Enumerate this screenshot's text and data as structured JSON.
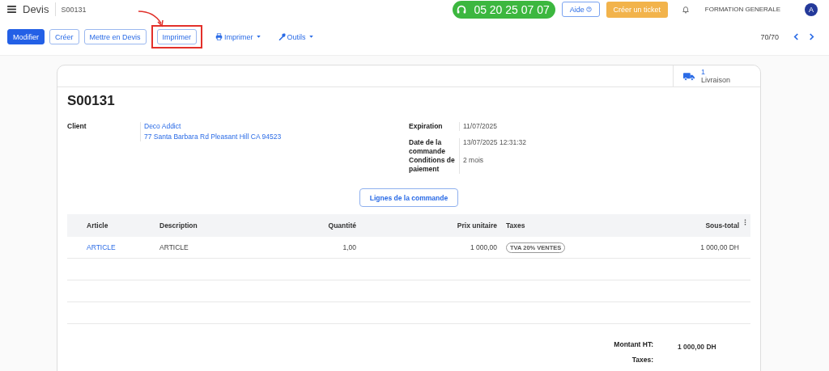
{
  "topbar": {
    "app_title": "Devis",
    "breadcrumb": "S00131",
    "phone": "05 20 25 07 07",
    "help_button": "Aide",
    "ticket_button": "Créer un ticket",
    "company": "FORMATION GENERALE",
    "avatar_initial": "A"
  },
  "toolbar": {
    "buttons": [
      {
        "label": "Modifier",
        "kind": "primary",
        "highlighted": false
      },
      {
        "label": "Créer",
        "kind": "outline",
        "highlighted": false
      },
      {
        "label": "Mettre en Devis",
        "kind": "outline",
        "highlighted": false
      },
      {
        "label": "Imprimer",
        "kind": "outline",
        "highlighted": true
      },
      {
        "label": "Imprimer",
        "kind": "print-menu",
        "highlighted": false
      },
      {
        "label": "Outils",
        "kind": "tools-menu",
        "highlighted": false
      }
    ],
    "pager": "70/70"
  },
  "form": {
    "stat_button": {
      "count": "1",
      "label": "Livraison"
    },
    "title": "S00131",
    "left_fields": [
      {
        "label": "Client",
        "values": [
          "Deco Addict",
          "77 Santa Barbara Rd Pleasant Hill CA 94523"
        ]
      }
    ],
    "right_fields": [
      {
        "label": "Expiration",
        "value": "11/07/2025"
      },
      {
        "label": "Date de la commande",
        "value": "13/07/2025 12:31:32"
      },
      {
        "label": "Conditions de paiement",
        "value": "2 mois"
      }
    ],
    "section_button": "Lignes de la commande",
    "table": {
      "columns": [
        "Article",
        "Description",
        "Quantité",
        "Prix unitaire",
        "Taxes",
        "Sous-total"
      ],
      "rows": [
        {
          "article": "ARTICLE",
          "description": "ARTICLE",
          "quantity": "1,00",
          "unit_price": "1 000,00",
          "tax": "TVA 20% VENTES",
          "subtotal": "1 000,00 DH"
        }
      ]
    },
    "totals": [
      {
        "label": "Montant HT:",
        "value": "1 000,00 DH"
      },
      {
        "label": "Taxes:"
      }
    ]
  }
}
